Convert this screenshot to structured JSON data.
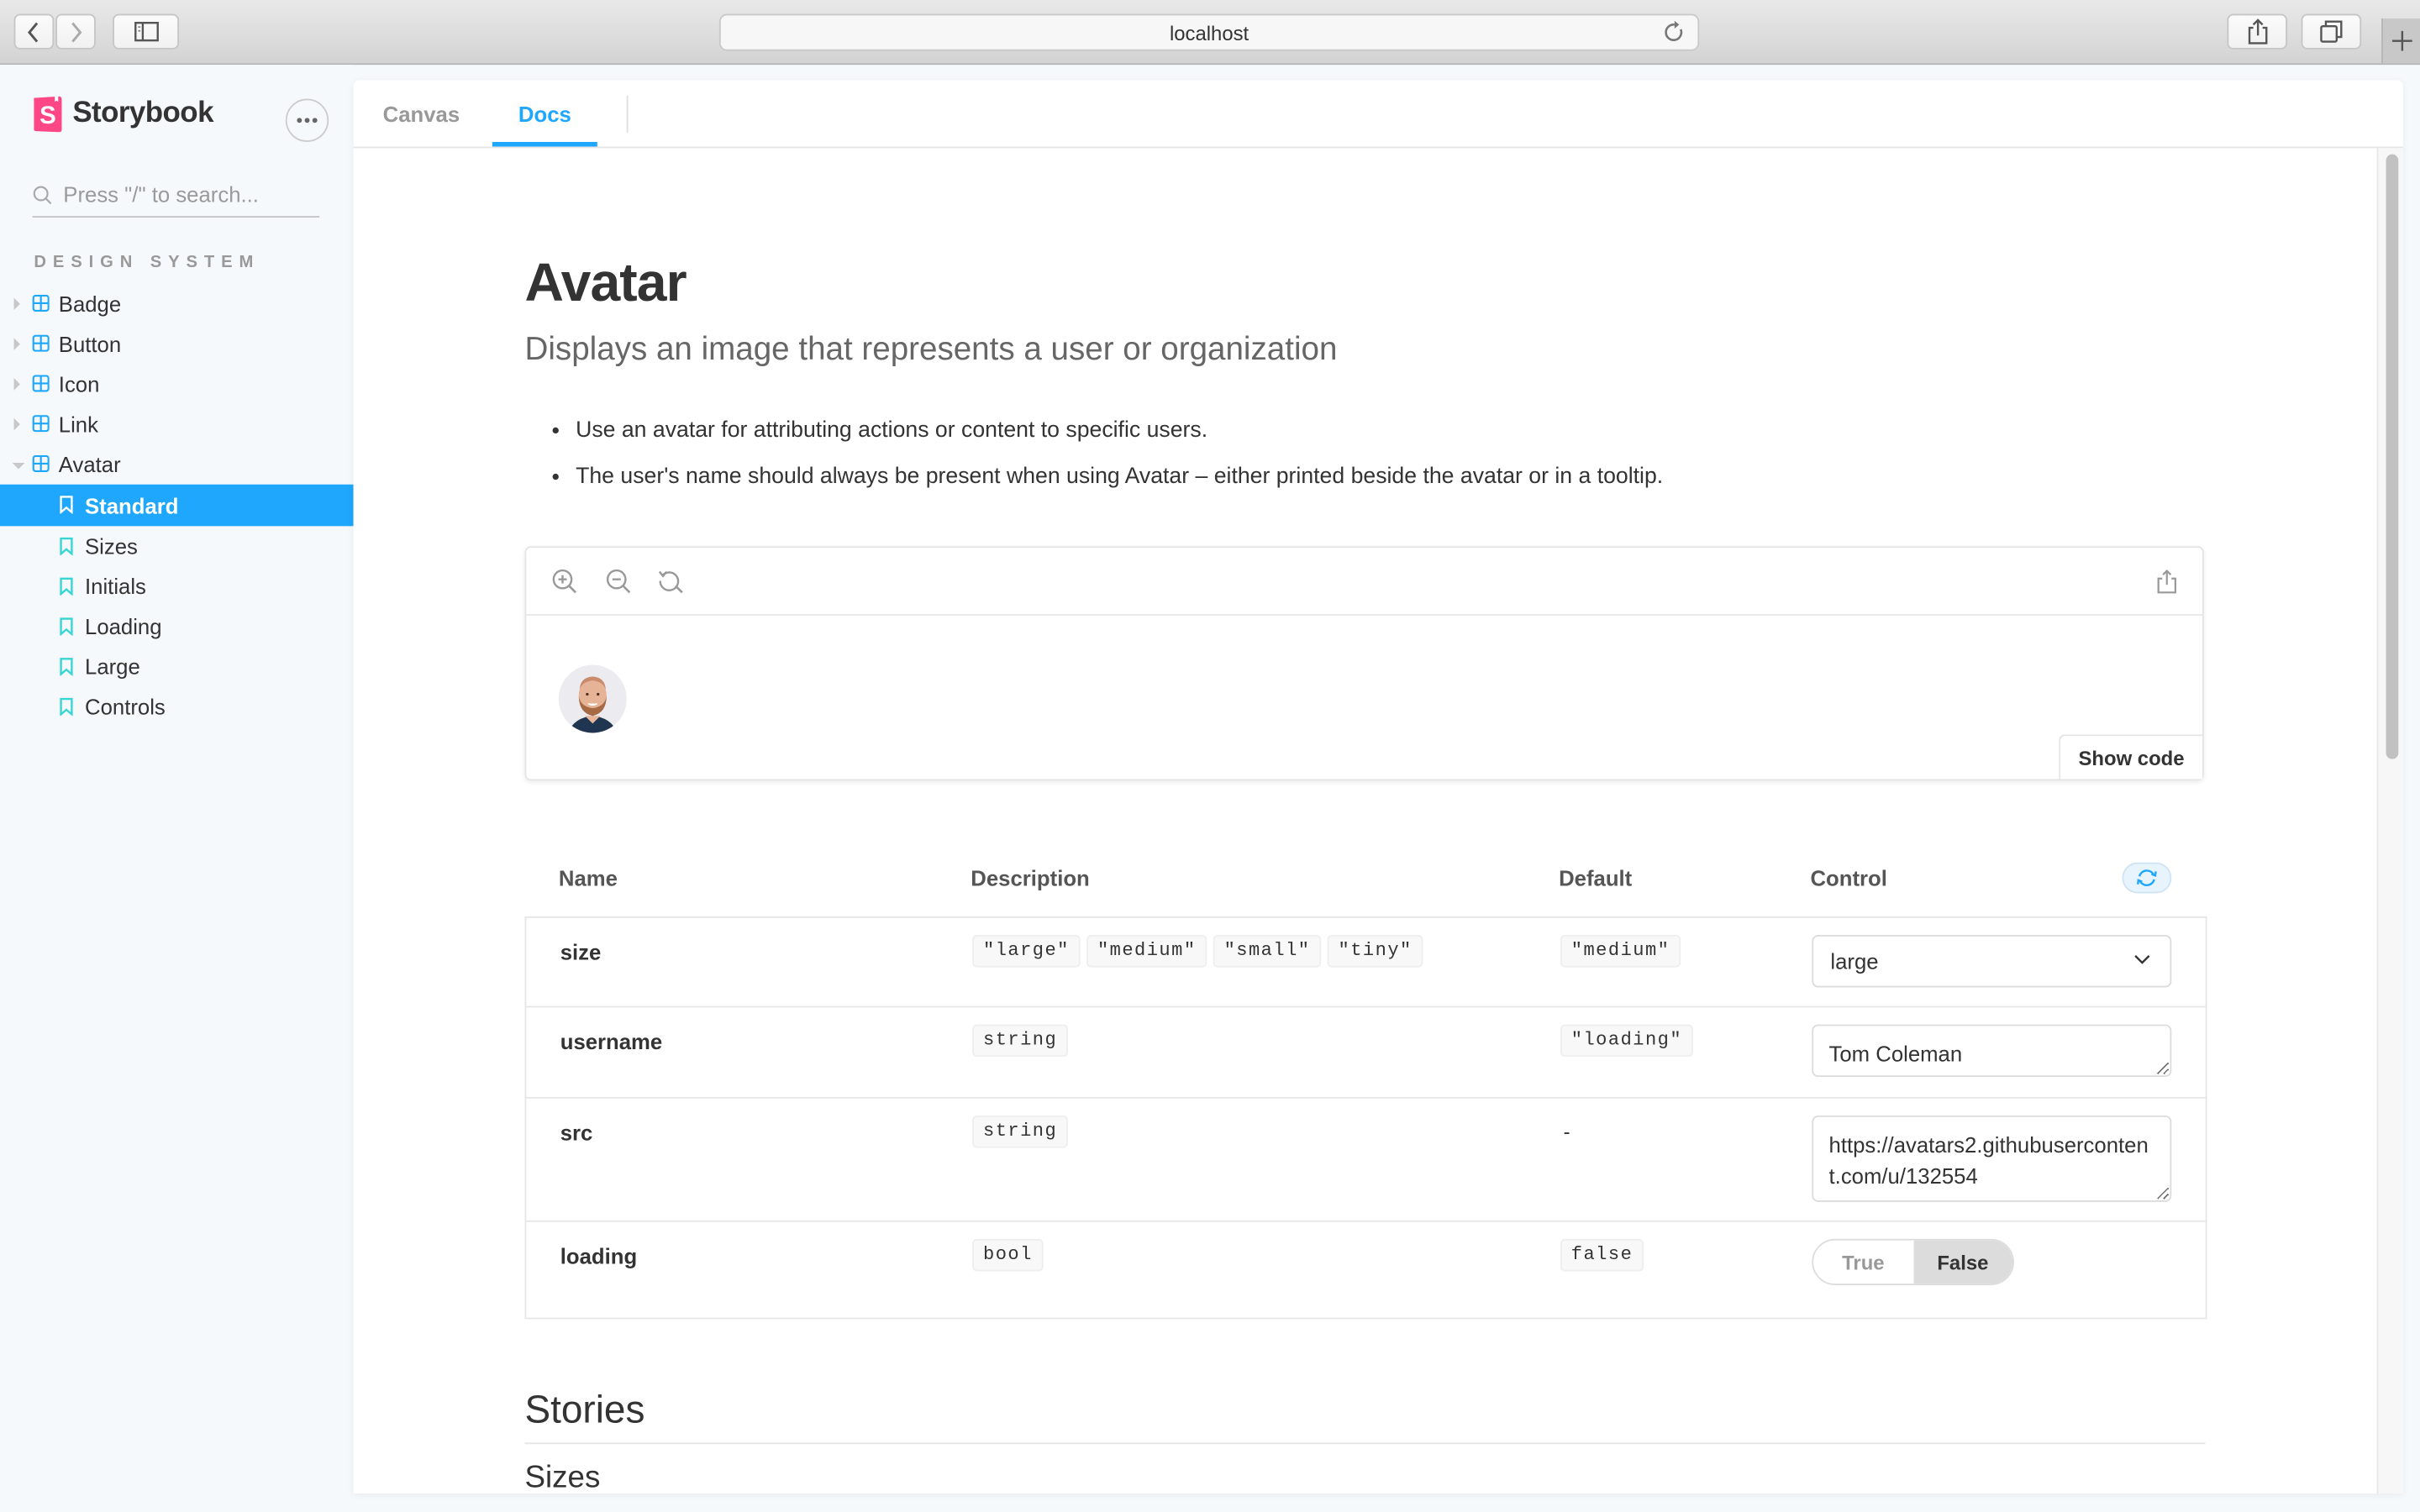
{
  "browser": {
    "url": "localhost",
    "icons": {
      "back": "chevron-left-icon",
      "forward": "chevron-right-icon",
      "sidebar": "sidebar-toggle-icon",
      "reload": "reload-icon",
      "share": "share-icon",
      "tabs": "tab-overview-icon",
      "new_tab": "plus-icon"
    }
  },
  "sidebar": {
    "brand": "Storybook",
    "brand_color": "#ff4785",
    "search_placeholder": "Press \"/\" to search...",
    "section_title": "DESIGN SYSTEM",
    "components": [
      {
        "label": "Badge",
        "expanded": false
      },
      {
        "label": "Button",
        "expanded": false
      },
      {
        "label": "Icon",
        "expanded": false
      },
      {
        "label": "Link",
        "expanded": false
      },
      {
        "label": "Avatar",
        "expanded": true
      }
    ],
    "stories": [
      {
        "label": "Standard",
        "selected": true
      },
      {
        "label": "Sizes",
        "selected": false
      },
      {
        "label": "Initials",
        "selected": false
      },
      {
        "label": "Loading",
        "selected": false
      },
      {
        "label": "Large",
        "selected": false
      },
      {
        "label": "Controls",
        "selected": false
      }
    ],
    "accent_color": "#1ea7fd",
    "story_icon_color": "#37d5d3"
  },
  "tabs": [
    {
      "label": "Canvas",
      "active": false
    },
    {
      "label": "Docs",
      "active": true
    }
  ],
  "doc": {
    "title": "Avatar",
    "subtitle": "Displays an image that represents a user or organization",
    "bullets": [
      "Use an avatar for attributing actions or content to specific users.",
      "The user's name should always be present when using Avatar – either printed beside the avatar or in a tooltip."
    ],
    "preview": {
      "toolbar_icons": [
        "zoom-in-icon",
        "zoom-out-icon",
        "zoom-reset-icon",
        "share-icon"
      ],
      "show_code_label": "Show code",
      "avatar_alt": "Tom Coleman"
    },
    "args_table": {
      "headers": {
        "name": "Name",
        "description": "Description",
        "default": "Default",
        "control": "Control"
      },
      "rows": [
        {
          "name": "size",
          "description": [
            "\"large\"",
            "\"medium\"",
            "\"small\"",
            "\"tiny\""
          ],
          "default": "\"medium\"",
          "control": {
            "type": "select",
            "value": "large"
          }
        },
        {
          "name": "username",
          "description": [
            "string"
          ],
          "default": "\"loading\"",
          "control": {
            "type": "text",
            "value": "Tom Coleman"
          }
        },
        {
          "name": "src",
          "description": [
            "string"
          ],
          "default": "-",
          "control": {
            "type": "text",
            "value": "https://avatars2.githubusercontent.com/u/132554"
          }
        },
        {
          "name": "loading",
          "description": [
            "bool"
          ],
          "default": "false",
          "control": {
            "type": "boolean",
            "true_label": "True",
            "false_label": "False",
            "value": false
          }
        }
      ]
    },
    "stories_heading": "Stories",
    "first_story_heading": "Sizes"
  }
}
